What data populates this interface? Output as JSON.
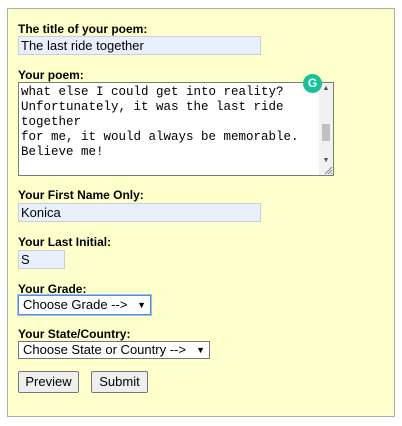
{
  "form": {
    "title_label": "The title of your poem:",
    "title_value": "The last ride together",
    "poem_label": "Your poem:",
    "poem_lines": [
      "what else I could get into reality?",
      "Unfortunately, it was the last ride",
      "together",
      "for me, it would always be memorable.",
      "Believe me!"
    ],
    "first_name_label": "Your First Name Only:",
    "first_name_value": "Konica",
    "last_initial_label": "Your Last Initial:",
    "last_initial_value": "S",
    "grade_label": "Your Grade:",
    "grade_selected": "Choose Grade -->",
    "state_label": "Your State/Country:",
    "state_selected": "Choose State or Country -->",
    "preview_button": "Preview",
    "submit_button": "Submit"
  },
  "icons": {
    "grammarly": "grammarly-icon",
    "dropdown": "chevron-down-icon"
  },
  "colors": {
    "panel_background": "#ffffcc",
    "autofill_background": "#e8f0fe",
    "grammarly_green": "#15c39a",
    "focus_border": "#4a90e2"
  }
}
